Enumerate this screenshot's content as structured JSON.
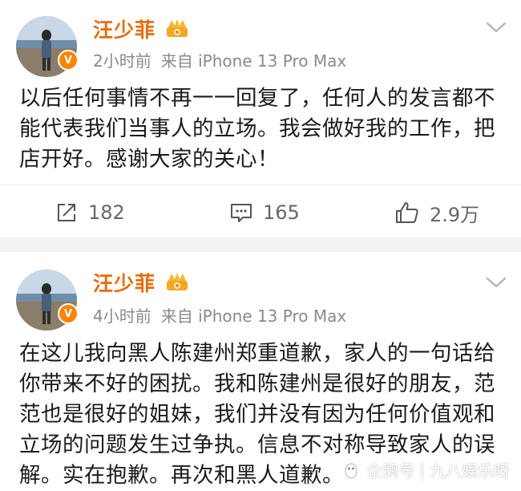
{
  "posts": [
    {
      "username": "汪少菲",
      "time": "2小时前",
      "source": "来自 iPhone 13 Pro Max",
      "text": "以后任何事情不再一一回复了，任何人的发言都不能代表我们当事人的立场。我会做好我的工作，把店开好。感谢大家的关心！",
      "shares": "182",
      "comments": "165",
      "likes": "2.9万",
      "verified_badge": "V"
    },
    {
      "username": "汪少菲",
      "time": "4小时前",
      "source": "来自 iPhone 13 Pro Max",
      "text": "在这儿我向黑人陈建州郑重道歉，家人的一句话给你带来不好的困扰。我和陈建州是很好的朋友，范范也是很好的姐妹，我们并没有因为任何价值观和立场的问题发生过争执。信息不对称导致家人的误解。实在抱歉。再次和黑人道歉。",
      "verified_badge": "V"
    }
  ],
  "watermark": {
    "platform": "企鹅号",
    "author": "九八娱乐呀"
  },
  "colors": {
    "username": "#e86b0c",
    "meta": "#8a8a8a",
    "verified": "#ff8200",
    "separator": "#f2f2f2"
  },
  "icons": [
    "avatar-photo",
    "verified-v-icon",
    "member-crown-icon",
    "chevron-down-icon",
    "share-icon",
    "comment-icon",
    "like-icon",
    "penguin-icon"
  ]
}
